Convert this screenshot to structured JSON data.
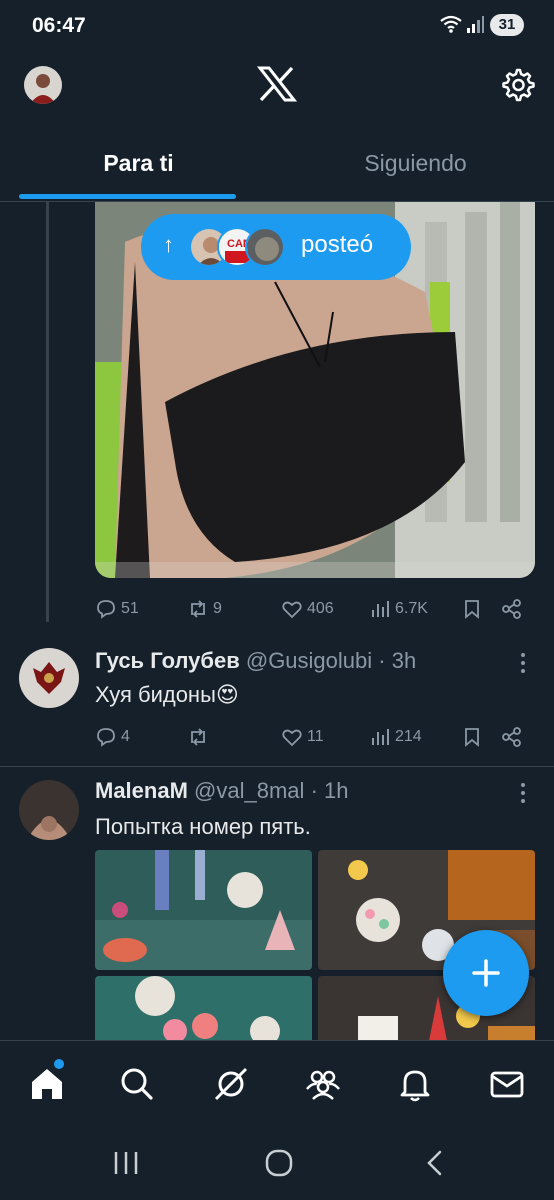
{
  "status_bar": {
    "time": "06:47",
    "battery": "31"
  },
  "header": {
    "tabs": [
      {
        "label": "Para ti",
        "active": true
      },
      {
        "label": "Siguiendo",
        "active": false
      }
    ]
  },
  "posted_pill": {
    "label": "posteó",
    "avatar_badge": "CANADA"
  },
  "first_post_actions": {
    "replies": "51",
    "retweets": "9",
    "likes": "406",
    "views": "6.7K"
  },
  "tweets": [
    {
      "name": "Гусь Голубев",
      "handle": "@Gusigolubi",
      "time": "· 3h",
      "text": "Хуя бидоны😍",
      "replies": "4",
      "retweets": "",
      "likes": "11",
      "views": "214"
    },
    {
      "name": "MalenaM",
      "handle": "@val_8mal",
      "time": "· 1h",
      "text": "Попытка номер пять."
    }
  ],
  "colors": {
    "background": "#15202b",
    "accent": "#1d9bf0",
    "muted": "#8b98a5",
    "border": "#38444d"
  },
  "icons": {
    "nav": [
      "home-icon",
      "search-icon",
      "grok-icon",
      "communities-icon",
      "notifications-icon",
      "messages-icon"
    ],
    "system": [
      "recent-apps-icon",
      "home-circle-icon",
      "back-icon"
    ]
  }
}
